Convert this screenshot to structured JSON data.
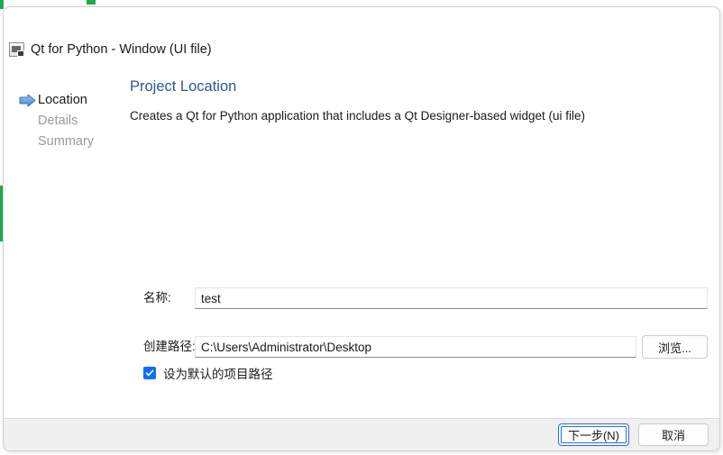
{
  "window": {
    "title": "Qt for Python - Window (UI file)",
    "icon": "qt-designer-icon"
  },
  "steps": [
    {
      "label": "Location",
      "state": "active",
      "icon": "blue-right-arrow-icon"
    },
    {
      "label": "Details",
      "state": "inactive"
    },
    {
      "label": "Summary",
      "state": "inactive"
    }
  ],
  "page": {
    "title": "Project Location",
    "description": "Creates a Qt for Python application that includes a Qt Designer-based widget (ui file)"
  },
  "form": {
    "name": {
      "label": "名称:",
      "value": "test",
      "placeholder": ""
    },
    "path": {
      "label": "创建路径:",
      "value": "C:\\Users\\Administrator\\Desktop",
      "placeholder": ""
    },
    "browse_label": "浏览...",
    "default_path_checkbox": {
      "label": "设为默认的项目路径",
      "checked": true
    }
  },
  "footer": {
    "next_label": "下一步(N)",
    "cancel_label": "取消"
  },
  "colors": {
    "accent": "#2b579a",
    "checkbox": "#0d6efd",
    "default_button_border": "#2b6fd6",
    "inactive_step": "#9a9a9a",
    "footer_bg": "#f0f0f0"
  }
}
